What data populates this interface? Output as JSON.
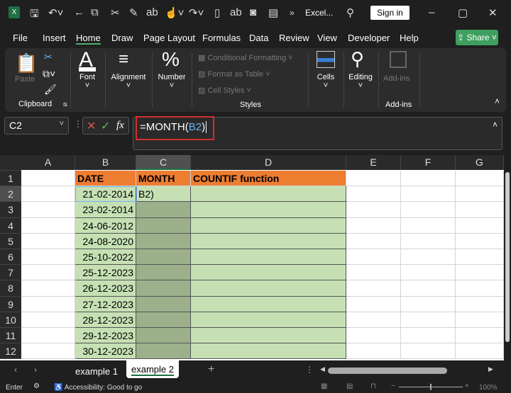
{
  "titlebar": {
    "app_title": "Excel...",
    "sign_in": "Sign in",
    "overflow": "»"
  },
  "menu": [
    "File",
    "Insert",
    "Home",
    "Draw",
    "Page Layout",
    "Formulas",
    "Data",
    "Review",
    "View",
    "Developer",
    "Help"
  ],
  "share": "Share",
  "ribbon": {
    "paste": "Paste",
    "clipboard": "Clipboard",
    "font": "Font",
    "alignment": "Alignment",
    "number": "Number",
    "conditional_formatting": "Conditional Formatting",
    "format_as_table": "Format as Table",
    "cell_styles": "Cell Styles",
    "styles": "Styles",
    "cells": "Cells",
    "editing": "Editing",
    "addins_btn": "Add-ins",
    "addins_group": "Add-ins"
  },
  "formula_bar": {
    "name_box": "C2",
    "formula_prefix": "=MONTH(",
    "formula_ref": "B2",
    "formula_suffix": ")",
    "fx": "fx"
  },
  "columns": [
    "A",
    "B",
    "C",
    "D",
    "E",
    "F",
    "G"
  ],
  "rows": [
    "1",
    "2",
    "3",
    "4",
    "5",
    "6",
    "7",
    "8",
    "9",
    "10",
    "11",
    "12"
  ],
  "headers": {
    "b": "DATE",
    "c": "MONTH",
    "d": "COUNTIF function"
  },
  "dates": [
    "21-02-2014",
    "23-02-2014",
    "24-06-2012",
    "24-08-2020",
    "25-10-2022",
    "25-12-2023",
    "26-12-2023",
    "27-12-2023",
    "28-12-2023",
    "29-12-2023",
    "30-12-2023"
  ],
  "editing_cell": "B2)",
  "sheets": [
    "example 1",
    "example 2"
  ],
  "active_sheet": "example 2",
  "status": {
    "mode": "Enter",
    "accessibility": "Accessibility: Good to go",
    "zoom": "100%"
  },
  "colors": {
    "header_orange": "#ED7D31",
    "cell_green": "#C6E0B4",
    "selected_green": "#9CB08C",
    "accent": "#3f9f5f"
  }
}
